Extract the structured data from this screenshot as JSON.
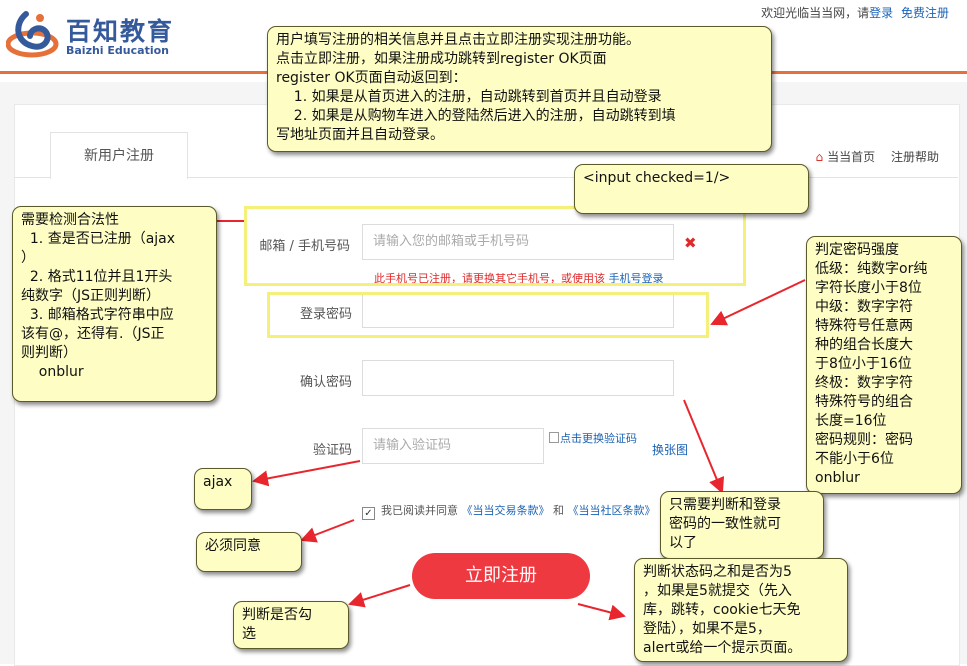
{
  "header": {
    "logo": {
      "cn": "百知教育",
      "en": "Baizhi Education"
    },
    "welcome": "欢迎光临当当网，请",
    "login_link": "登录",
    "register_link": "免费注册"
  },
  "tab": {
    "label": "新用户注册"
  },
  "breadcrumbs": {
    "home": "当当首页",
    "help": "注册帮助"
  },
  "form": {
    "email": {
      "label": "邮箱 / 手机号码",
      "placeholder": "请输入您的邮箱或手机号码",
      "error": "此手机号已注册，请更换其它手机号，或使用该",
      "error_link": "手机号登录"
    },
    "password": {
      "label": "登录密码"
    },
    "confirm": {
      "label": "确认密码"
    },
    "captcha": {
      "label": "验证码",
      "placeholder": "请输入验证码",
      "image_alt": "点击更换验证码",
      "change": "换张图"
    },
    "agree": {
      "text": "我已阅读并同意",
      "link1": "《当当交易条款》",
      "and": "和",
      "link2": "《当当社区条款》"
    },
    "submit": "立即注册"
  },
  "notes": {
    "top": "用户填写注册的相关信息并且点击立即注册实现注册功能。\n点击立即注册，如果注册成功跳转到register OK页面\nregister OK页面自动返回到：\n    1. 如果是从首页进入的注册，自动跳转到首页并且自动登录\n    2. 如果是从购物车进入的登陆然后进入的注册，自动跳转到填\n写地址页面并且自动登录。",
    "checked": "<input checked=1/>",
    "legality": "需要检测合法性\n  1. 查是否已注册（ajax\n）\n  2. 格式11位并且1开头\n纯数字（JS正则判断）\n  3. 邮箱格式字符串中应\n该有@，还得有.（JS正\n则判断）\n    onblur",
    "strength": "判定密码强度\n低级：纯数字or纯\n字符长度小于8位\n中级：数字字符\n特殊符号任意两\n种的组合长度大\n于8位小于16位\n终极：数字字符\n特殊符号的组合\n长度=16位\n密码规则：密码\n不能小于6位\nonblur",
    "ajax": "ajax",
    "consistency": "只需要判断和登录\n密码的一致性就可\n以了",
    "must_agree": "必须同意",
    "status": "判断状态码之和是否为5\n，如果是5就提交（先入\n库，跳转，cookie七天免\n登陆），如果不是5，\nalert或给一个提示页面。",
    "check_box": "判断是否勾\n选"
  }
}
